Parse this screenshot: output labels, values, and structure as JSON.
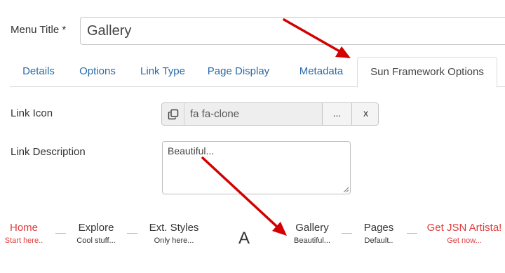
{
  "form": {
    "menu_title_label": "Menu Title *",
    "menu_title_value": "Gallery"
  },
  "tabs": [
    {
      "label": "Details"
    },
    {
      "label": "Options"
    },
    {
      "label": "Link Type"
    },
    {
      "label": "Page Display"
    },
    {
      "label": "Metadata"
    },
    {
      "label": "Sun Framework Options",
      "active": true
    }
  ],
  "link_icon": {
    "label": "Link Icon",
    "value": "fa fa-clone",
    "icon": "clone-icon",
    "select_button": "...",
    "clear_button": "x"
  },
  "link_description": {
    "label": "Link Description",
    "value": "Beautiful..."
  },
  "preview_menu": {
    "items": [
      {
        "title": "Home",
        "desc": "Start here..",
        "color": "#e03c3c"
      },
      {
        "title": "Explore",
        "desc": "Cool stuff..."
      },
      {
        "title": "Ext. Styles",
        "desc": "Only here..."
      },
      {
        "title": "Gallery",
        "desc": "Beautiful..."
      },
      {
        "title": "Pages",
        "desc": "Default.."
      },
      {
        "title": "Get JSN Artista!",
        "desc": "Get now...",
        "color": "#e03c3c"
      }
    ],
    "logo_text": "A"
  },
  "colors": {
    "link": "#2a6aa8",
    "accent_red": "#e03c3c",
    "arrow": "#d40000"
  }
}
